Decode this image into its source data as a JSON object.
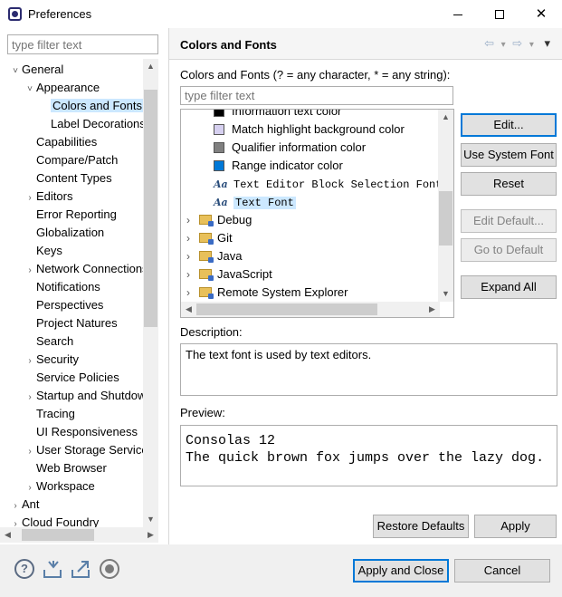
{
  "window": {
    "title": "Preferences",
    "minimize": "–",
    "maximize": "□",
    "close": "✕"
  },
  "left": {
    "filter_placeholder": "type filter text",
    "tree": [
      {
        "label": "General",
        "level": 0,
        "twisty": "˅"
      },
      {
        "label": "Appearance",
        "level": 1,
        "twisty": "˅"
      },
      {
        "label": "Colors and Fonts",
        "level": 2,
        "twisty": "",
        "selected": true
      },
      {
        "label": "Label Decorations",
        "level": 2,
        "twisty": ""
      },
      {
        "label": "Capabilities",
        "level": 1,
        "twisty": ""
      },
      {
        "label": "Compare/Patch",
        "level": 1,
        "twisty": ""
      },
      {
        "label": "Content Types",
        "level": 1,
        "twisty": ""
      },
      {
        "label": "Editors",
        "level": 1,
        "twisty": "›"
      },
      {
        "label": "Error Reporting",
        "level": 1,
        "twisty": ""
      },
      {
        "label": "Globalization",
        "level": 1,
        "twisty": ""
      },
      {
        "label": "Keys",
        "level": 1,
        "twisty": ""
      },
      {
        "label": "Network Connections",
        "level": 1,
        "twisty": "›"
      },
      {
        "label": "Notifications",
        "level": 1,
        "twisty": ""
      },
      {
        "label": "Perspectives",
        "level": 1,
        "twisty": ""
      },
      {
        "label": "Project Natures",
        "level": 1,
        "twisty": ""
      },
      {
        "label": "Search",
        "level": 1,
        "twisty": ""
      },
      {
        "label": "Security",
        "level": 1,
        "twisty": "›"
      },
      {
        "label": "Service Policies",
        "level": 1,
        "twisty": ""
      },
      {
        "label": "Startup and Shutdown",
        "level": 1,
        "twisty": "›"
      },
      {
        "label": "Tracing",
        "level": 1,
        "twisty": ""
      },
      {
        "label": "UI Responsiveness",
        "level": 1,
        "twisty": ""
      },
      {
        "label": "User Storage Service",
        "level": 1,
        "twisty": "›"
      },
      {
        "label": "Web Browser",
        "level": 1,
        "twisty": ""
      },
      {
        "label": "Workspace",
        "level": 1,
        "twisty": "›"
      },
      {
        "label": "Ant",
        "level": 0,
        "twisty": "›"
      },
      {
        "label": "Cloud Foundry",
        "level": 0,
        "twisty": "›"
      }
    ]
  },
  "right": {
    "title": "Colors and Fonts",
    "nav": {
      "back": "⇦",
      "back_menu": "▾",
      "forward": "⇨",
      "forward_menu": "▾",
      "view_menu": "▾"
    },
    "hint": "Colors and Fonts (? = any character, * = any string):",
    "filter_placeholder": "type filter text",
    "items": [
      {
        "kind": "color",
        "label": "Information text color",
        "color": "#000000"
      },
      {
        "kind": "color",
        "label": "Match highlight background color",
        "color": "#d6d0f0"
      },
      {
        "kind": "color",
        "label": "Qualifier information color",
        "color": "#808080"
      },
      {
        "kind": "color",
        "label": "Range indicator color",
        "color": "#0078d7"
      },
      {
        "kind": "font",
        "label": "Text Editor Block Selection Font",
        "icon": "Aa"
      },
      {
        "kind": "font-selected",
        "label": "Text Font",
        "icon": "Aa"
      },
      {
        "kind": "folder",
        "label": "Debug",
        "twisty": "›"
      },
      {
        "kind": "folder",
        "label": "Git",
        "twisty": "›"
      },
      {
        "kind": "folder",
        "label": "Java",
        "twisty": "›"
      },
      {
        "kind": "folder",
        "label": "JavaScript",
        "twisty": "›"
      },
      {
        "kind": "folder",
        "label": "Remote System Explorer",
        "twisty": "›"
      }
    ],
    "buttons": {
      "edit": "Edit...",
      "use_system_font": "Use System Font",
      "reset": "Reset",
      "edit_default": "Edit Default...",
      "go_to_default": "Go to Default",
      "expand_all": "Expand All"
    },
    "description_label": "Description:",
    "description": "The text font is used by text editors.",
    "preview_label": "Preview:",
    "preview_line1": "Consolas 12",
    "preview_line2": "The quick brown fox jumps over the lazy dog.",
    "restore_defaults": "Restore Defaults",
    "apply": "Apply"
  },
  "bottom": {
    "apply_and_close": "Apply and Close",
    "cancel": "Cancel",
    "help_glyph": "?"
  }
}
